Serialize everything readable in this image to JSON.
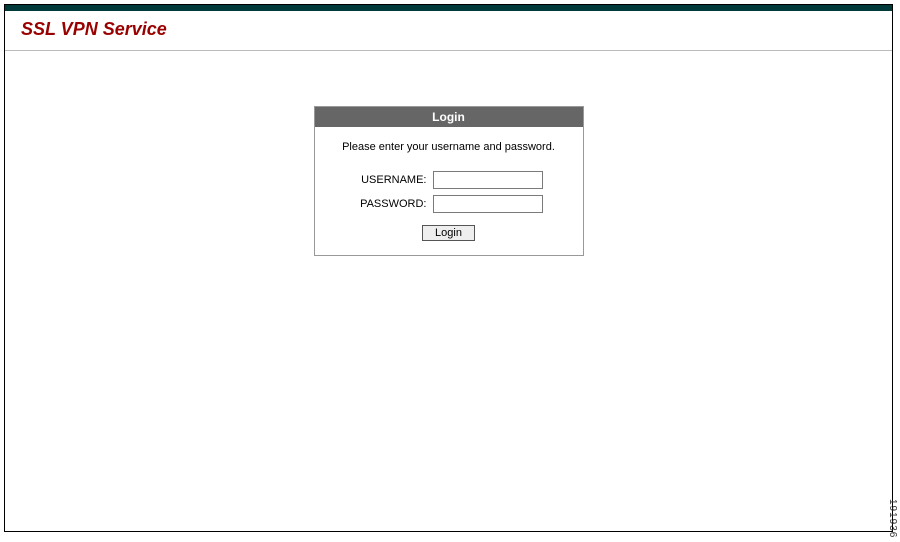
{
  "header": {
    "title": "SSL VPN Service"
  },
  "login": {
    "panel_title": "Login",
    "prompt": "Please enter your username and password.",
    "username_label": "USERNAME:",
    "password_label": "PASSWORD:",
    "username_value": "",
    "password_value": "",
    "button_label": "Login"
  },
  "footer": {
    "image_number": "191936"
  }
}
